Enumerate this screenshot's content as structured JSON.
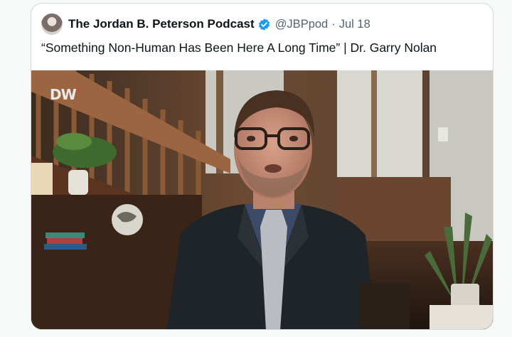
{
  "tweet": {
    "author_name": "The Jordan B. Peterson Podcast",
    "handle": "@JBPpod",
    "separator": "·",
    "date": "Jul 18",
    "text": "“Something Non-Human Has Been Here A Long Time” | Dr. Garry Nolan",
    "media": {
      "watermark": "DW"
    }
  },
  "icons": {
    "verified": "verified-badge-icon",
    "avatar": "avatar"
  },
  "colors": {
    "verified": "#1d9bf0",
    "text": "#0f1419",
    "secondary": "#536471",
    "border": "#cfd9de"
  }
}
